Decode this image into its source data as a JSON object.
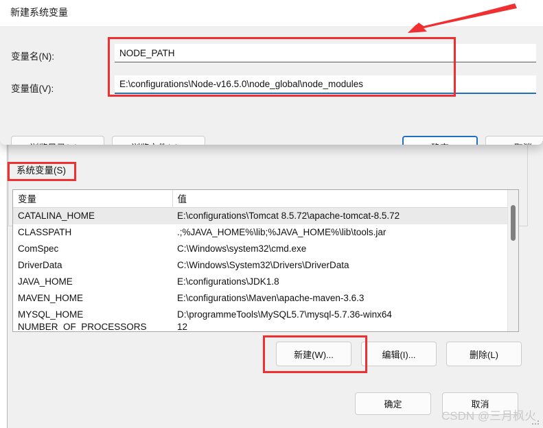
{
  "dialog": {
    "title": "新建系统变量",
    "labels": {
      "name": "变量名(N):",
      "value": "变量值(V):"
    },
    "fields": {
      "name_value": "NODE_PATH",
      "name_placeholder": "",
      "value_value": "E:\\configurations\\Node-v16.5.0\\node_global\\node_modules",
      "value_placeholder": ""
    },
    "buttons": {
      "browse_dir": "浏览目录(D)...",
      "browse_file": "浏览文件(F)...",
      "ok": "确定",
      "cancel": "取消"
    }
  },
  "background": {
    "group_label": "系统变量(S)",
    "table": {
      "headers": [
        "变量",
        "值"
      ],
      "rows": [
        {
          "variable": "CATALINA_HOME",
          "value": "E:\\configurations\\Tomcat 8.5.72\\apache-tomcat-8.5.72",
          "selected": true
        },
        {
          "variable": "CLASSPATH",
          "value": ".;%JAVA_HOME%\\lib;%JAVA_HOME%\\lib\\tools.jar",
          "selected": false
        },
        {
          "variable": "ComSpec",
          "value": "C:\\Windows\\system32\\cmd.exe",
          "selected": false
        },
        {
          "variable": "DriverData",
          "value": "C:\\Windows\\System32\\Drivers\\DriverData",
          "selected": false
        },
        {
          "variable": "JAVA_HOME",
          "value": "E:\\configurations\\JDK1.8",
          "selected": false
        },
        {
          "variable": "MAVEN_HOME",
          "value": "E:\\configurations\\Maven\\apache-maven-3.6.3",
          "selected": false
        },
        {
          "variable": "MYSQL_HOME",
          "value": "D:\\programmeTools\\MySQL5.7\\mysql-5.7.36-winx64",
          "selected": false
        },
        {
          "variable": "NUMBER_OF_PROCESSORS",
          "value": "12",
          "selected": false
        }
      ]
    },
    "buttons": {
      "new": "新建(W)...",
      "edit": "编辑(I)...",
      "delete": "删除(L)",
      "ok": "确定",
      "cancel": "取消"
    }
  },
  "annotations": {
    "watermark": "CSDN @三月枫火",
    "highlight_color": "#f03030",
    "arrow_color": "#f03030",
    "focus_color": "#1f6fc4"
  }
}
